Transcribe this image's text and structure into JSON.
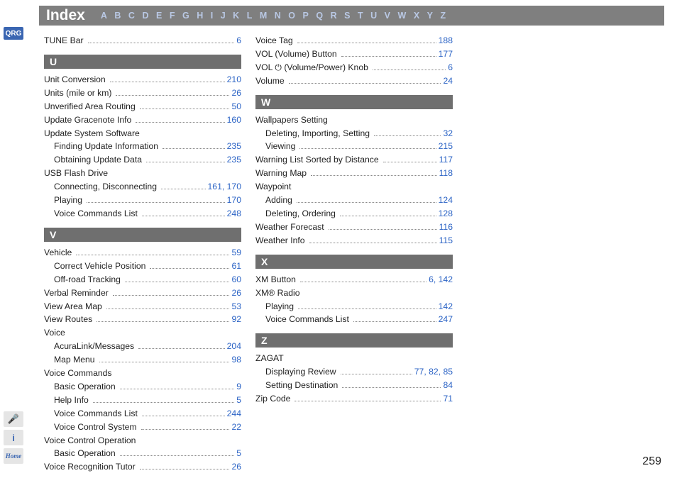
{
  "header": {
    "title": "Index",
    "alphabet": [
      "A",
      "B",
      "C",
      "D",
      "E",
      "F",
      "G",
      "H",
      "I",
      "J",
      "K",
      "L",
      "M",
      "N",
      "O",
      "P",
      "Q",
      "R",
      "S",
      "T",
      "U",
      "V",
      "W",
      "X",
      "Y",
      "Z"
    ]
  },
  "side": {
    "qrgLabel": "QRG",
    "voiceIcon": "🎤",
    "infoIcon": "i",
    "homeIcon": "Home"
  },
  "pageNumber": "259",
  "indexColumns": [
    [
      {
        "type": "row",
        "label": "TUNE Bar",
        "pages": [
          "6"
        ]
      },
      {
        "type": "section",
        "letter": "U"
      },
      {
        "type": "row",
        "label": "Unit Conversion",
        "pages": [
          "210"
        ]
      },
      {
        "type": "row",
        "label": "Units (mile or km)",
        "pages": [
          "26"
        ]
      },
      {
        "type": "row",
        "label": "Unverified Area Routing",
        "pages": [
          "50"
        ]
      },
      {
        "type": "row",
        "label": "Update Gracenote Info",
        "pages": [
          "160"
        ]
      },
      {
        "type": "heading",
        "label": "Update System Software"
      },
      {
        "type": "row",
        "sub": true,
        "label": "Finding Update Information",
        "pages": [
          "235"
        ]
      },
      {
        "type": "row",
        "sub": true,
        "label": "Obtaining Update Data",
        "pages": [
          "235"
        ]
      },
      {
        "type": "heading",
        "label": "USB Flash Drive"
      },
      {
        "type": "row",
        "sub": true,
        "label": "Connecting, Disconnecting",
        "pages": [
          "161",
          "170"
        ]
      },
      {
        "type": "row",
        "sub": true,
        "label": "Playing",
        "pages": [
          "170"
        ]
      },
      {
        "type": "row",
        "sub": true,
        "label": "Voice Commands List",
        "pages": [
          "248"
        ]
      },
      {
        "type": "section",
        "letter": "V"
      },
      {
        "type": "row",
        "label": "Vehicle",
        "pages": [
          "59"
        ]
      },
      {
        "type": "row",
        "sub": true,
        "label": "Correct Vehicle Position",
        "pages": [
          "61"
        ]
      },
      {
        "type": "row",
        "sub": true,
        "label": "Off-road Tracking",
        "pages": [
          "60"
        ]
      },
      {
        "type": "row",
        "label": "Verbal Reminder",
        "pages": [
          "26"
        ]
      },
      {
        "type": "row",
        "label": "View Area Map",
        "pages": [
          "53"
        ]
      },
      {
        "type": "row",
        "label": "View Routes",
        "pages": [
          "92"
        ]
      },
      {
        "type": "heading",
        "label": "Voice"
      },
      {
        "type": "row",
        "sub": true,
        "label": "AcuraLink/Messages",
        "pages": [
          "204"
        ]
      },
      {
        "type": "row",
        "sub": true,
        "label": "Map Menu",
        "pages": [
          "98"
        ]
      },
      {
        "type": "heading",
        "label": "Voice Commands"
      },
      {
        "type": "row",
        "sub": true,
        "label": "Basic Operation",
        "pages": [
          "9"
        ]
      },
      {
        "type": "row",
        "sub": true,
        "label": "Help Info",
        "pages": [
          "5"
        ]
      },
      {
        "type": "row",
        "sub": true,
        "label": "Voice Commands List",
        "pages": [
          "244"
        ]
      },
      {
        "type": "row",
        "sub": true,
        "label": "Voice Control System",
        "pages": [
          "22"
        ]
      },
      {
        "type": "heading",
        "label": "Voice Control Operation"
      },
      {
        "type": "row",
        "sub": true,
        "label": "Basic Operation",
        "pages": [
          "5"
        ]
      },
      {
        "type": "row",
        "label": "Voice Recognition Tutor",
        "pages": [
          "26"
        ]
      }
    ],
    [
      {
        "type": "row",
        "label": "Voice Tag",
        "pages": [
          "188"
        ]
      },
      {
        "type": "row",
        "label": "VOL (Volume) Button",
        "pages": [
          "177"
        ]
      },
      {
        "type": "row",
        "label": "VOL ⏻ (Volume/Power) Knob",
        "pages": [
          "6"
        ]
      },
      {
        "type": "row",
        "label": "Volume",
        "pages": [
          "24"
        ]
      },
      {
        "type": "section",
        "letter": "W"
      },
      {
        "type": "heading",
        "label": "Wallpapers Setting"
      },
      {
        "type": "row",
        "sub": true,
        "label": "Deleting, Importing, Setting",
        "pages": [
          "32"
        ]
      },
      {
        "type": "row",
        "sub": true,
        "label": "Viewing",
        "pages": [
          "215"
        ]
      },
      {
        "type": "row",
        "label": "Warning List Sorted by Distance",
        "pages": [
          "117"
        ]
      },
      {
        "type": "row",
        "label": "Warning Map",
        "pages": [
          "118"
        ]
      },
      {
        "type": "heading",
        "label": "Waypoint"
      },
      {
        "type": "row",
        "sub": true,
        "label": "Adding",
        "pages": [
          "124"
        ]
      },
      {
        "type": "row",
        "sub": true,
        "label": "Deleting, Ordering",
        "pages": [
          "128"
        ]
      },
      {
        "type": "row",
        "label": "Weather Forecast",
        "pages": [
          "116"
        ]
      },
      {
        "type": "row",
        "label": "Weather Info",
        "pages": [
          "115"
        ]
      },
      {
        "type": "section",
        "letter": "X"
      },
      {
        "type": "row",
        "label": "XM Button",
        "pages": [
          "6",
          "142"
        ]
      },
      {
        "type": "heading",
        "label": "XM® Radio"
      },
      {
        "type": "row",
        "sub": true,
        "label": "Playing",
        "pages": [
          "142"
        ]
      },
      {
        "type": "row",
        "sub": true,
        "label": "Voice Commands List",
        "pages": [
          "247"
        ]
      },
      {
        "type": "section",
        "letter": "Z"
      },
      {
        "type": "heading",
        "label": "ZAGAT"
      },
      {
        "type": "row",
        "sub": true,
        "label": "Displaying Review",
        "pages": [
          "77",
          "82",
          "85"
        ]
      },
      {
        "type": "row",
        "sub": true,
        "label": "Setting Destination",
        "pages": [
          "84"
        ]
      },
      {
        "type": "row",
        "label": "Zip Code",
        "pages": [
          "71"
        ]
      }
    ],
    []
  ]
}
